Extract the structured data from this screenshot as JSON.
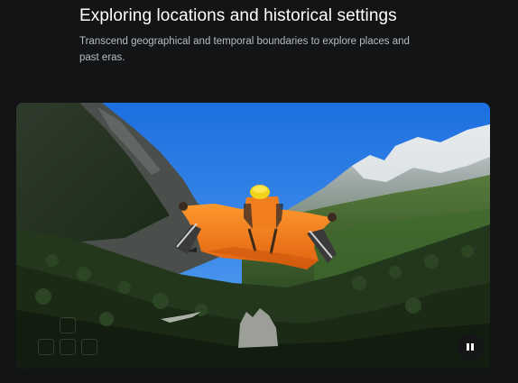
{
  "section": {
    "title": "Exploring locations and historical settings",
    "description": "Transcend geographical and temporal boundaries to explore places and past eras."
  },
  "media": {
    "icon": "pause-icon",
    "overlay_keys": [
      "arrow-up-key",
      "arrow-left-key",
      "arrow-down-key",
      "arrow-right-key"
    ]
  },
  "colors": {
    "background": "#131416",
    "title": "#ffffff",
    "subtitle": "#b8bcc6",
    "sky": "#2f7fe6",
    "wingsuit": "#f07d1e",
    "forest": "#23371c"
  }
}
